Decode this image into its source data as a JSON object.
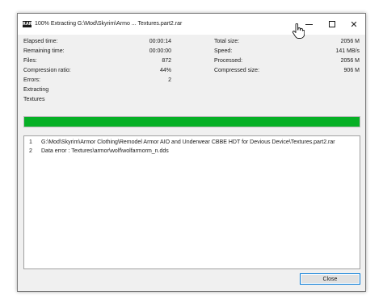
{
  "window": {
    "title": "100% Extracting G:\\Mod\\Skyrim\\Armo ... Textures.part2.rar",
    "app_icon_text": "RAR",
    "accent_color": "#0078d7"
  },
  "stats_left": [
    {
      "label": "Elapsed time:",
      "value": "00:00:14"
    },
    {
      "label": "Remaining time:",
      "value": "00:00:00"
    },
    {
      "label": "Files:",
      "value": "872"
    },
    {
      "label": "Compression ratio:",
      "value": "44%"
    },
    {
      "label": "Errors:",
      "value": "2"
    }
  ],
  "stats_right": [
    {
      "label": "Total size:",
      "value": "2056 M"
    },
    {
      "label": "Speed:",
      "value": "141 MB/s"
    },
    {
      "label": "Processed:",
      "value": "2056 M"
    },
    {
      "label": "Compressed size:",
      "value": "906 M"
    }
  ],
  "status": {
    "action": "Extracting",
    "current": "Textures"
  },
  "progress": {
    "fraction": 1.0,
    "color": "#06b025"
  },
  "log": [
    {
      "num": "1",
      "text": "G:\\Mod\\Skyrim\\Armor Clothing\\Remodel Armor AIO and Underwear CBBE HDT for Devious Device\\Textures.part2.rar"
    },
    {
      "num": "2",
      "text": "Data error : Textures\\armor\\wolf\\wolfarmorm_n.dds"
    }
  ],
  "buttons": {
    "close_label": "Close"
  }
}
